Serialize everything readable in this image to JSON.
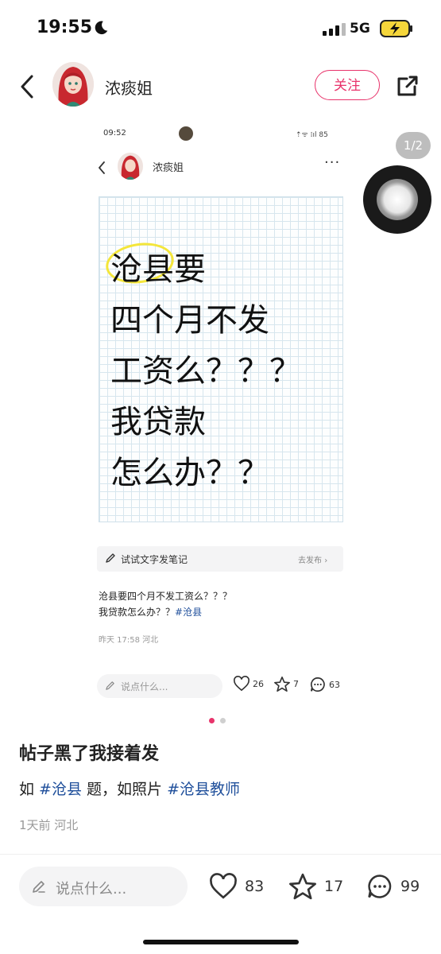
{
  "status_bar": {
    "time": "19:55",
    "network": "5G",
    "battery_charging": true
  },
  "header": {
    "author": "浓痰姐",
    "follow_label": "关注"
  },
  "pager": "1/2",
  "inner": {
    "time": "09:52",
    "status_right": "⇡ᯤ ⁞ıl 85",
    "author": "浓痰姐",
    "more": "···",
    "card_lines": [
      "沧县要",
      "四个月不发",
      "工资么？？？",
      "我贷款",
      "怎么办？？"
    ],
    "tip_label": "试试文字发笔记",
    "tip_action": "去发布",
    "body_line1": "沧县要四个月不发工资么？？？",
    "body_line2_text": "我贷款怎么办？？",
    "body_tag": "#沧县",
    "meta": "昨天 17:58 河北",
    "comment_placeholder": "说点什么...",
    "likes": "26",
    "stars": "7",
    "comments": "63"
  },
  "post": {
    "title": "帖子黑了我接着发",
    "body_prefix": "如 ",
    "tag1": "#沧县",
    "body_mid": " 题，如照片 ",
    "tag2": "#沧县教师",
    "meta": "1天前 河北"
  },
  "bottom": {
    "comment_placeholder": "说点什么...",
    "likes": "83",
    "stars": "17",
    "comments": "99"
  },
  "colors": {
    "accent": "#e8336b",
    "tag": "#1f4f9b",
    "highlight": "#f4e63a"
  }
}
